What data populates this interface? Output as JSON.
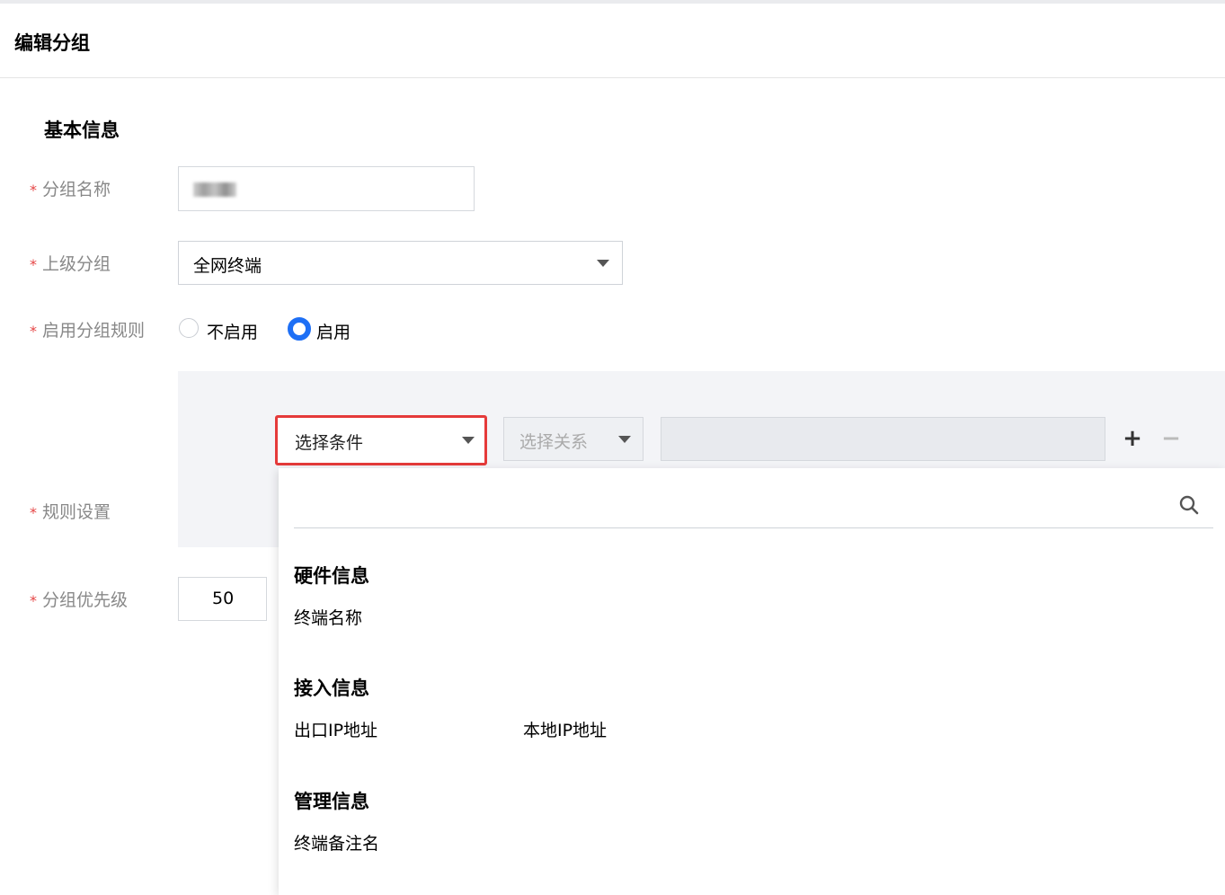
{
  "page": {
    "title": "编辑分组"
  },
  "basic_info": {
    "section_title": "基本信息",
    "required_mark": "*",
    "group_name": {
      "label": "分组名称",
      "value": ""
    },
    "parent_group": {
      "label": "上级分组",
      "value": "全网终端"
    },
    "enable_rule": {
      "label": "启用分组规则",
      "options": [
        "不启用",
        "启用"
      ],
      "selected": "启用"
    },
    "rule_setting": {
      "label": "规则设置",
      "condition_placeholder": "选择条件",
      "relation_placeholder": "选择关系",
      "value": ""
    },
    "priority": {
      "label": "分组优先级",
      "value": "50"
    }
  },
  "controls": {
    "add_symbol": "+",
    "remove_symbol": "−"
  },
  "dropdown": {
    "search_value": "",
    "groups": [
      {
        "title": "硬件信息",
        "items": [
          "终端名称"
        ]
      },
      {
        "title": "接入信息",
        "items": [
          "出口IP地址",
          "本地IP地址"
        ]
      },
      {
        "title": "管理信息",
        "items": [
          "终端备注名"
        ]
      }
    ]
  },
  "colors": {
    "accent": "#1e6ff5",
    "required": "#e54545",
    "highlight_border": "#e53a3a",
    "rule_panel_bg": "#f3f4f7"
  },
  "icons": {
    "dropdown_caret": "caret-down-icon",
    "search": "search-icon"
  }
}
